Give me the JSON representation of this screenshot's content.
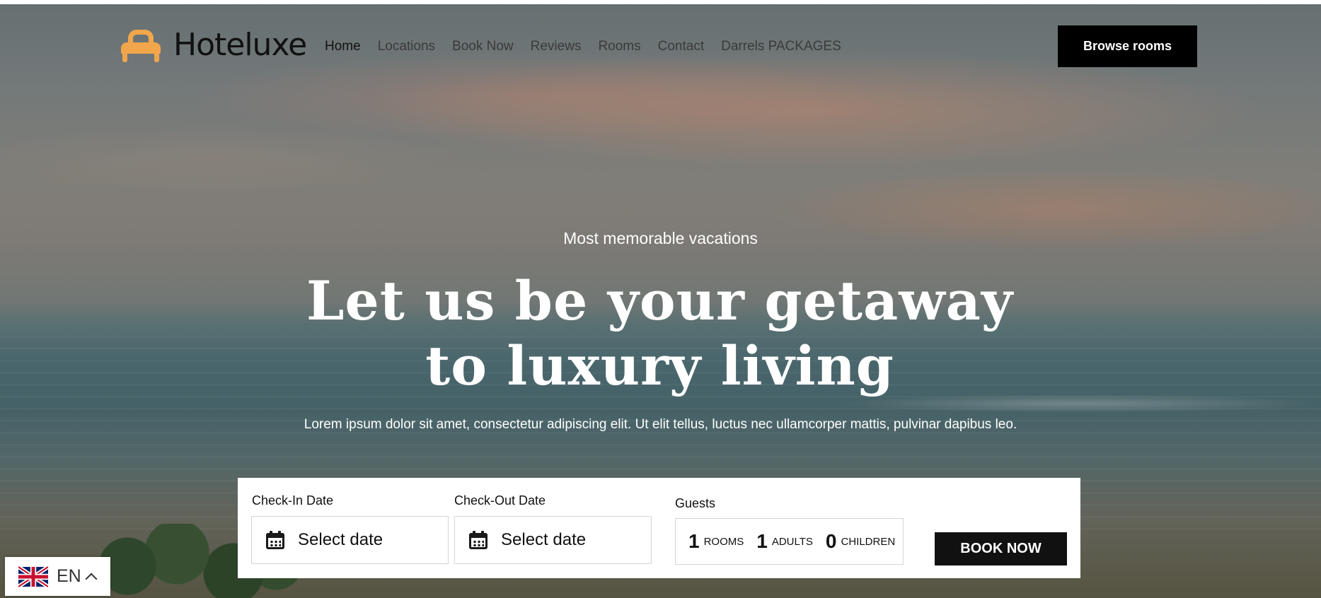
{
  "brand": {
    "name": "Hoteluxe",
    "accent_color": "#f2a64b",
    "icon": "bed-icon"
  },
  "nav": {
    "items": [
      {
        "label": "Home",
        "active": true
      },
      {
        "label": "Locations",
        "active": false
      },
      {
        "label": "Book Now",
        "active": false
      },
      {
        "label": "Reviews",
        "active": false
      },
      {
        "label": "Rooms",
        "active": false
      },
      {
        "label": "Contact",
        "active": false
      },
      {
        "label": "Darrels PACKAGES",
        "active": false
      }
    ]
  },
  "header": {
    "cta_label": "Browse rooms"
  },
  "hero": {
    "eyebrow": "Most memorable vacations",
    "headline": "Let us be your getaway to luxury living",
    "subtext": "Lorem ipsum dolor sit amet, consectetur adipiscing elit. Ut elit tellus, luctus nec ullamcorper mattis, pulvinar dapibus leo."
  },
  "booking": {
    "checkin": {
      "label": "Check-In Date",
      "value": "Select date",
      "icon": "calendar-icon"
    },
    "checkout": {
      "label": "Check-Out Date",
      "value": "Select date",
      "icon": "calendar-icon"
    },
    "guests": {
      "label": "Guests",
      "rooms": {
        "count": "1",
        "label": "ROOMS"
      },
      "adults": {
        "count": "1",
        "label": "ADULTS"
      },
      "children": {
        "count": "0",
        "label": "CHILDREN"
      }
    },
    "submit_label": "BOOK NOW"
  },
  "language": {
    "code": "EN",
    "flag": "uk-flag-icon"
  }
}
